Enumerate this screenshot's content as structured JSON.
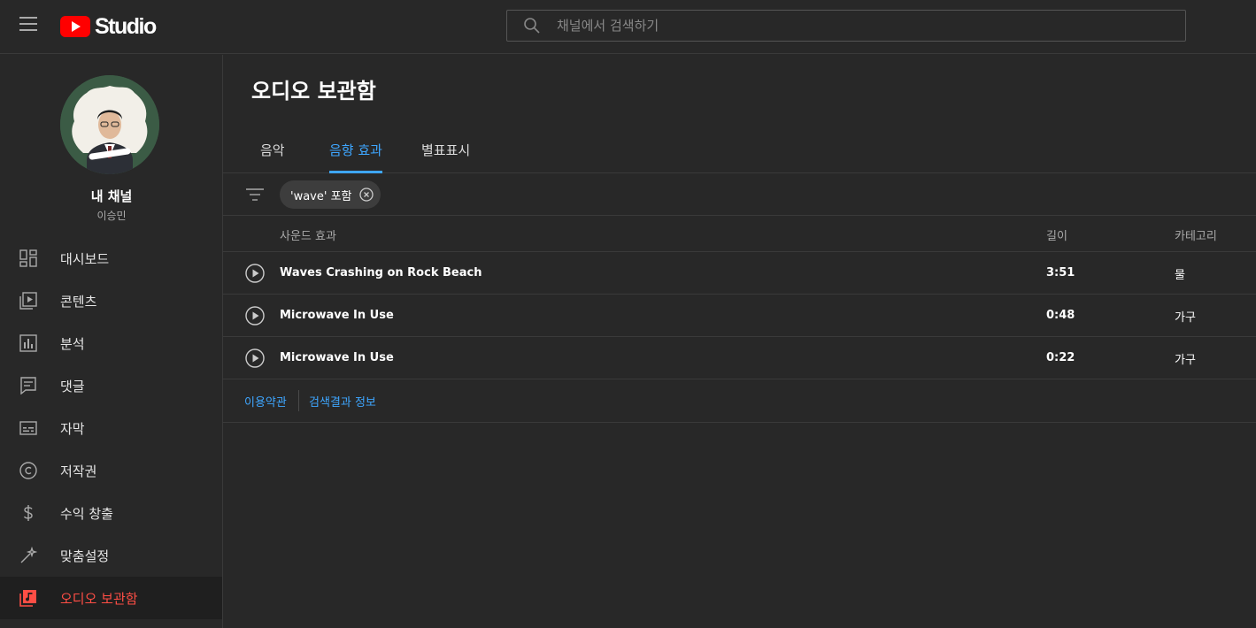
{
  "header": {
    "logo_text": "Studio",
    "search_placeholder": "채널에서 검색하기"
  },
  "sidebar": {
    "channel_name": "내 채널",
    "channel_owner": "이승민",
    "items": [
      {
        "label": "대시보드",
        "icon": "dashboard-icon"
      },
      {
        "label": "콘텐츠",
        "icon": "content-icon"
      },
      {
        "label": "분석",
        "icon": "analytics-icon"
      },
      {
        "label": "댓글",
        "icon": "comments-icon"
      },
      {
        "label": "자막",
        "icon": "subtitles-icon"
      },
      {
        "label": "저작권",
        "icon": "copyright-icon"
      },
      {
        "label": "수익 창출",
        "icon": "dollar-icon"
      },
      {
        "label": "맞춤설정",
        "icon": "magic-wand-icon"
      },
      {
        "label": "오디오 보관함",
        "icon": "audio-library-icon",
        "active": true
      }
    ]
  },
  "main": {
    "title": "오디오 보관함",
    "tabs": [
      {
        "label": "음악"
      },
      {
        "label": "음향 효과",
        "active": true
      },
      {
        "label": "별표표시"
      }
    ],
    "filter_chip": "'wave' 포함",
    "columns": {
      "name": "사운드 효과",
      "duration": "길이",
      "category": "카테고리"
    },
    "rows": [
      {
        "title": "Waves Crashing on Rock Beach",
        "duration": "3:51",
        "category": "물"
      },
      {
        "title": "Microwave In Use",
        "duration": "0:48",
        "category": "가구"
      },
      {
        "title": "Microwave In Use",
        "duration": "0:22",
        "category": "가구"
      }
    ],
    "footer_links": {
      "terms": "이용약관",
      "search_info": "검색결과 정보"
    }
  },
  "colors": {
    "accent_blue": "#3ea6ff",
    "active_red": "#ff4e45",
    "brand_red": "#ff0000"
  }
}
